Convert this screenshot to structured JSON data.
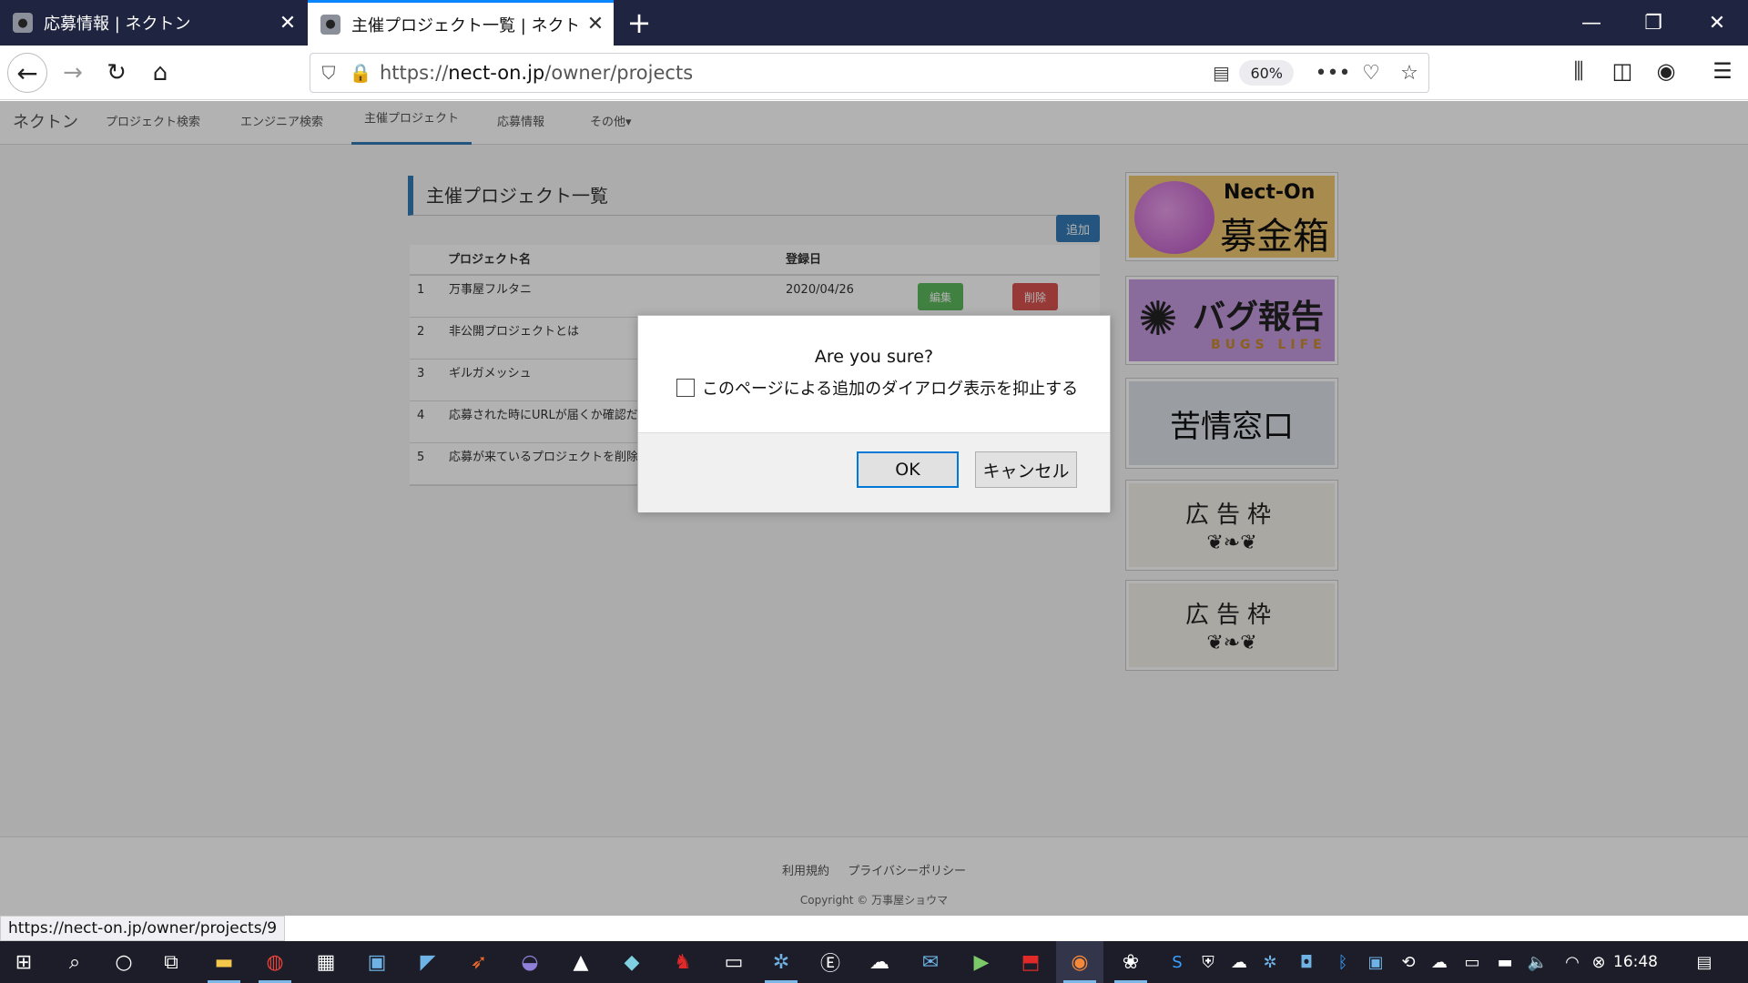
{
  "browser": {
    "tabs": [
      {
        "title": "応募情報 | ネクトン",
        "active": false
      },
      {
        "title": "主催プロジェクト一覧 | ネクトン",
        "active": true
      }
    ],
    "url_prefix": "https://",
    "url_host": "nect-on.jp",
    "url_path": "/owner/projects",
    "zoom": "60%",
    "status_url": "https://nect-on.jp/owner/projects/9"
  },
  "site_nav": {
    "brand": "ネクトン",
    "items": [
      "プロジェクト検索",
      "エンジニア検索",
      "主催プロジェクト",
      "応募情報",
      "その他"
    ]
  },
  "page": {
    "title": "主催プロジェクト一覧",
    "add_label": "追加",
    "columns": [
      "プロジェクト名",
      "登録日"
    ],
    "rows": [
      {
        "no": "1",
        "name": "万事屋フルタニ",
        "date": "2020/04/26"
      },
      {
        "no": "2",
        "name": "非公開プロジェクトとは",
        "date": ""
      },
      {
        "no": "3",
        "name": "ギルガメッシュ",
        "date": ""
      },
      {
        "no": "4",
        "name": "応募された時にURLが届くか確認だよ",
        "date": ""
      },
      {
        "no": "5",
        "name": "応募が来ているプロジェクトを削除し...",
        "date": ""
      }
    ],
    "edit_label": "編集",
    "delete_label": "削除"
  },
  "banners": {
    "donation": {
      "top": "Nect-On",
      "main": "募金箱"
    },
    "bug": {
      "main": "バグ報告",
      "sub": "BUGS LIFE"
    },
    "complaint": "苦情窓口",
    "ad1": "広告枠",
    "ad2": "広告枠"
  },
  "footer": {
    "links": [
      "利用規約",
      "プライバシーポリシー"
    ],
    "copyright": "Copyright © 万事屋ショウマ"
  },
  "dialog": {
    "message": "Are you sure?",
    "checkbox_label": "このページによる追加のダイアログ表示を抑止する",
    "ok_label": "OK",
    "cancel_label": "キャンセル"
  },
  "taskbar": {
    "clock": "16:48"
  }
}
